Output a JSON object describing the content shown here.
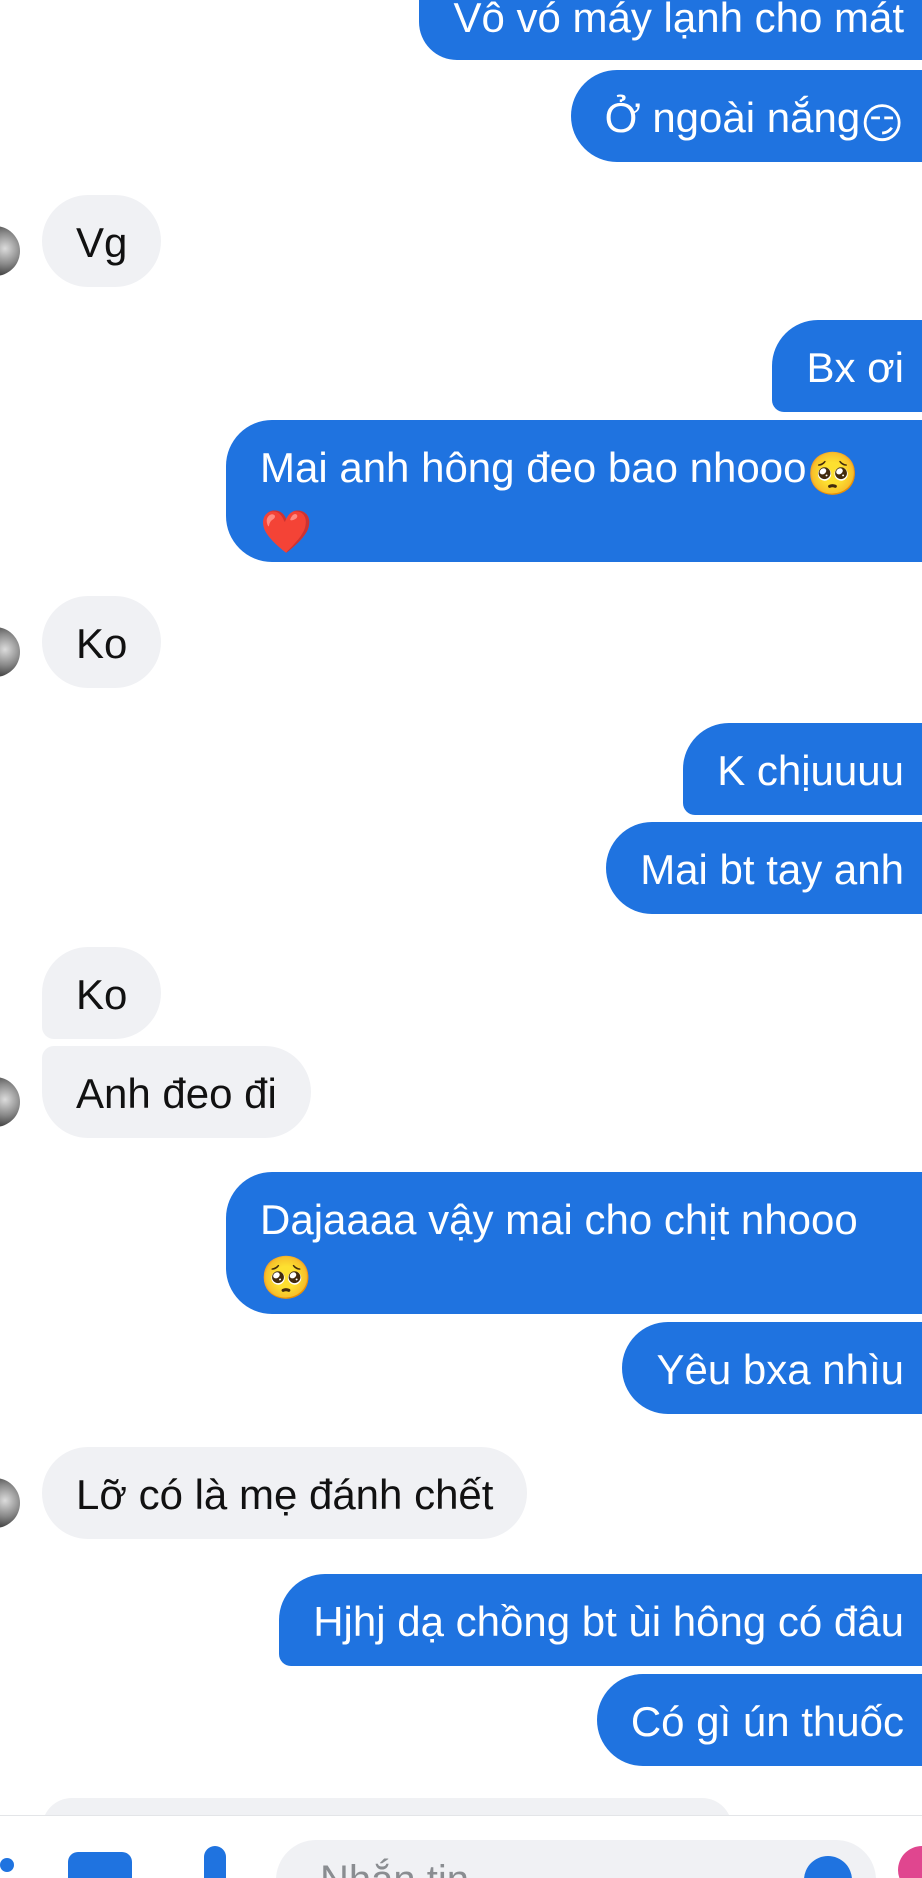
{
  "colors": {
    "sent_bubble": "#1f73e0",
    "received_bubble": "#f0f1f4",
    "accent": "#1f73e0"
  },
  "messages": [
    {
      "sender": "me",
      "text": "Vô vó máy lạnh cho mát"
    },
    {
      "sender": "me",
      "text": "Ở ngoài nắng",
      "emoji": "😏"
    },
    {
      "sender": "them",
      "text": "Vg"
    },
    {
      "sender": "me",
      "text": "Bx ơi"
    },
    {
      "sender": "me",
      "text": "Mai anh hông đeo bao nhooo",
      "emoji": "🥺",
      "emoji2": "❤️"
    },
    {
      "sender": "them",
      "text": "Ko"
    },
    {
      "sender": "me",
      "text": "K chịuuuu"
    },
    {
      "sender": "me",
      "text": "Mai bt tay anh"
    },
    {
      "sender": "them",
      "text": "Ko"
    },
    {
      "sender": "them",
      "text": "Anh đeo đi"
    },
    {
      "sender": "me",
      "text": "Dajaaaa vậy mai cho chịt nhooo",
      "emoji": "🥺"
    },
    {
      "sender": "me",
      "text": "Yêu bxa nhìu"
    },
    {
      "sender": "them",
      "text": "Lỡ có là mẹ đánh chết"
    },
    {
      "sender": "me",
      "text": "Hjhj dạ chồng bt ùi hông có đâu"
    },
    {
      "sender": "me",
      "text": "Có gì ún thuốc"
    }
  ],
  "composer": {
    "placeholder": "Nhắn tin",
    "icons": [
      "apps-icon",
      "gif-icon",
      "microphone-icon",
      "emoji-icon",
      "like-icon"
    ]
  }
}
